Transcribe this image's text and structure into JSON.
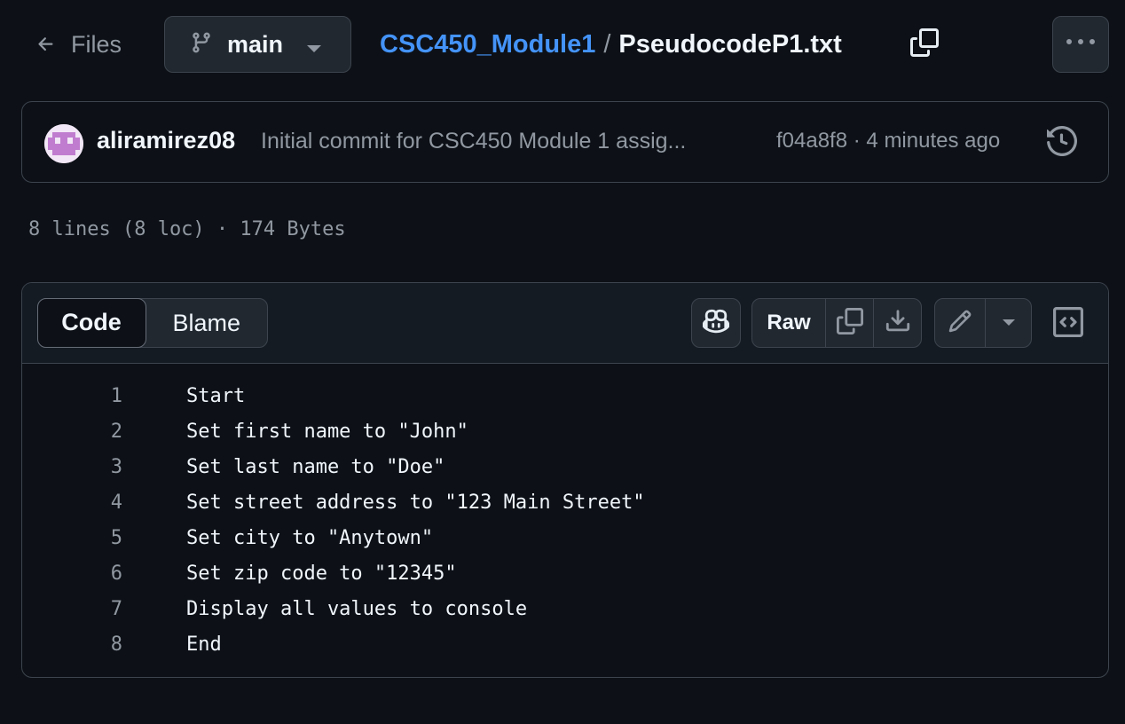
{
  "nav": {
    "files_label": "Files",
    "branch_name": "main"
  },
  "breadcrumb": {
    "repo": "CSC450_Module1",
    "separator": "/",
    "file": "PseudocodeP1.txt"
  },
  "commit": {
    "author": "aliramirez08",
    "message": "Initial commit for CSC450 Module 1 assig...",
    "sha": "f04a8f8",
    "dot": "·",
    "time": "4 minutes ago"
  },
  "file_info": "8 lines (8 loc) · 174 Bytes",
  "toolbar": {
    "code_tab": "Code",
    "blame_tab": "Blame",
    "raw_label": "Raw"
  },
  "code": {
    "lines": [
      {
        "n": "1",
        "text": "Start"
      },
      {
        "n": "2",
        "text": "Set first name to \"John\""
      },
      {
        "n": "3",
        "text": "Set last name to \"Doe\""
      },
      {
        "n": "4",
        "text": "Set street address to \"123 Main Street\""
      },
      {
        "n": "5",
        "text": "Set city to \"Anytown\""
      },
      {
        "n": "6",
        "text": "Set zip code to \"12345\""
      },
      {
        "n": "7",
        "text": "Display all values to console"
      },
      {
        "n": "8",
        "text": "End"
      }
    ]
  },
  "icons": [
    "arrow-left-icon",
    "git-branch-icon",
    "triangle-down-icon",
    "copy-icon",
    "kebab-horizontal-icon",
    "history-icon",
    "copilot-icon",
    "download-icon",
    "pencil-icon",
    "code-square-icon"
  ],
  "colors": {
    "background": "#0d1117",
    "link": "#4493f8",
    "muted": "#9198a1",
    "border": "#3d444d",
    "avatar": "#c07ccf"
  }
}
